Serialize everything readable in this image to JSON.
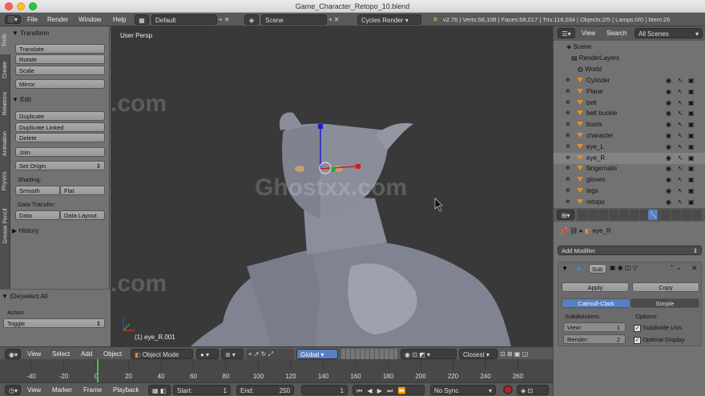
{
  "window": {
    "title": "Game_Character_Retopo_10.blend"
  },
  "colors": {
    "accent": "#5680c2",
    "orange": "#e38f2a",
    "bg": "#727272",
    "viewport": "#393939",
    "header": "#595959"
  },
  "info_header": {
    "menu": [
      "File",
      "Render",
      "Window",
      "Help"
    ],
    "layout": "Default",
    "scene": "Scene",
    "engine": "Cycles Render",
    "stats": "v2.76 | Verts:58,108 | Faces:58,017 | Tris:116,034 | Objects:2/5 | Lamps:0/0 | Mem:26"
  },
  "tool_tabs": [
    "Tools",
    "Create",
    "Relations",
    "Animation",
    "Physics",
    "Grease Pencil"
  ],
  "tools": {
    "transform_header": "Transform",
    "translate": "Translate",
    "rotate": "Rotate",
    "scale": "Scale",
    "mirror": "Mirror",
    "edit_header": "Edit",
    "duplicate": "Duplicate",
    "duplicate_linked": "Duplicate Linked",
    "delete": "Delete",
    "join": "Join",
    "set_origin": "Set Origin",
    "shading_label": "Shading:",
    "smooth": "Smooth",
    "flat": "Flat",
    "data_transfer_label": "Data Transfer:",
    "data": "Data",
    "data_layout": "Data Layout",
    "history_header": "History",
    "operator_header": "(De)select All",
    "action_label": "Action",
    "action_value": "Toggle"
  },
  "viewport": {
    "view_name": "User Persp",
    "active_object": "(1) eye_R.001",
    "watermark": "Ghostxx.com"
  },
  "view3d_header": {
    "menus": [
      "View",
      "Select",
      "Add",
      "Object"
    ],
    "mode": "Object Mode",
    "orientation": "Global",
    "snap": "Closest"
  },
  "timeline": {
    "ticks": [
      "-40",
      "-20",
      "0",
      "20",
      "40",
      "60",
      "80",
      "100",
      "120",
      "140",
      "160",
      "180",
      "200",
      "220",
      "240",
      "260"
    ],
    "current_frame": 1,
    "menus": [
      "View",
      "Marker",
      "Frame",
      "Playback"
    ],
    "start_label": "Start:",
    "start": "1",
    "end_label": "End:",
    "end": "250",
    "frame": "1",
    "sync": "No Sync"
  },
  "outliner": {
    "menus": [
      "View",
      "Search"
    ],
    "display": "All Scenes",
    "scene": "Scene",
    "render_layers": "RenderLayers",
    "world": "World",
    "objects": [
      "Cylinder",
      "Plane",
      "belt",
      "belt buckle",
      "boots",
      "character",
      "eye_L",
      "eye_R",
      "fiingernails",
      "gloves",
      "legs",
      "retopo"
    ]
  },
  "properties": {
    "object": "eye_R",
    "add_modifier": "Add Modifier",
    "modifier_name": "Sub",
    "apply": "Apply",
    "copy": "Copy",
    "tab_catmull": "Catmull-Clark",
    "tab_simple": "Simple",
    "subdivisions_label": "Subdivisions:",
    "options_label": "Options:",
    "view_label": "View:",
    "view_value": "1",
    "render_label": "Render:",
    "render_value": "2",
    "subdivide_uvs": "Subdivide UVs",
    "optimal_display": "Optimal Display"
  }
}
